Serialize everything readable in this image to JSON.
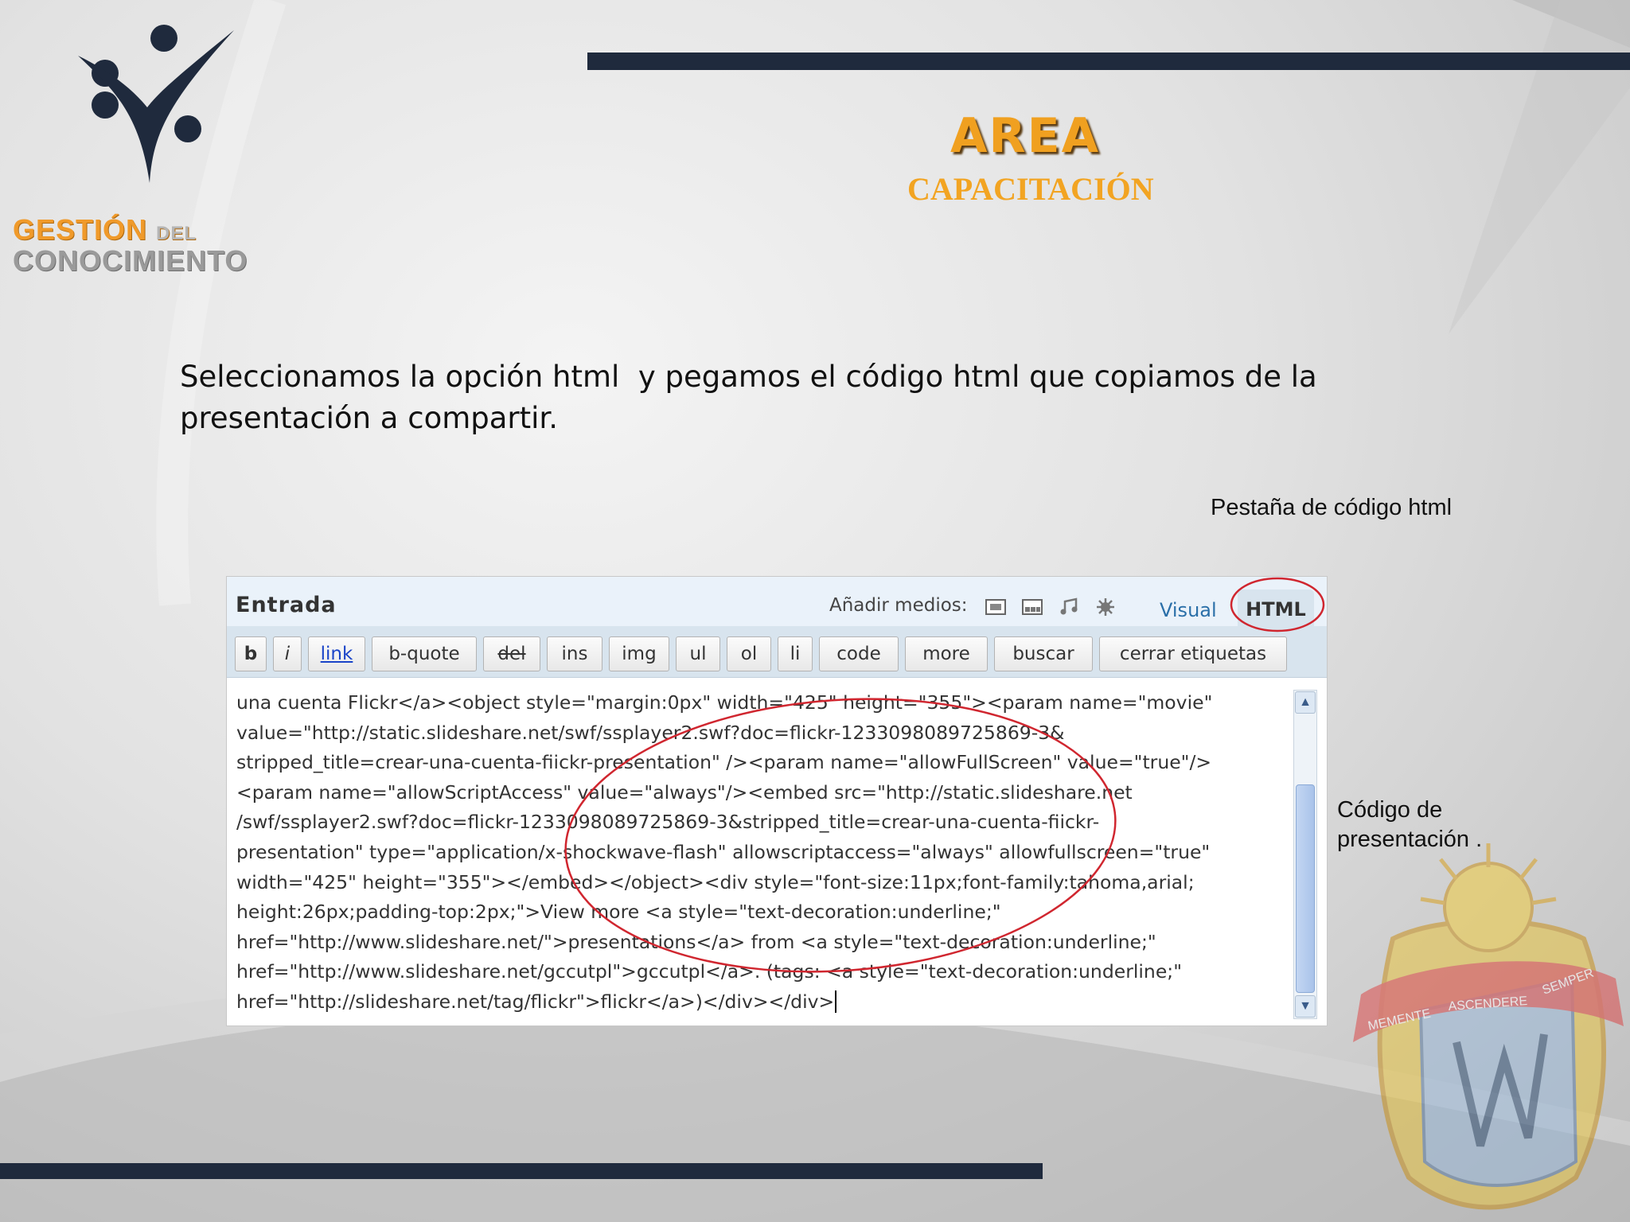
{
  "logo": {
    "line1": "GESTIÓN",
    "line1_small": "DEL",
    "line2": "CONOCIMIENTO"
  },
  "header": {
    "title": "AREA",
    "subtitle": "CAPACITACIÓN"
  },
  "instruction": {
    "line1": "Seleccionamos la opción html  y pegamos el código html que copiamos de la",
    "line2": "presentación a compartir."
  },
  "callouts": {
    "tab_label": "Pestaña de código html",
    "code_label_line1": "Código de",
    "code_label_line2": "presentación ."
  },
  "editor": {
    "title": "Entrada",
    "media_label": "Añadir medios:",
    "media_icons": [
      "image-icon",
      "video-icon",
      "audio-icon",
      "media-icon"
    ],
    "tab_visual": "Visual",
    "tab_html": "HTML",
    "buttons": [
      "b",
      "i",
      "link",
      "b-quote",
      "del",
      "ins",
      "img",
      "ul",
      "ol",
      "li",
      "code",
      "more",
      "buscar",
      "cerrar etiquetas"
    ],
    "content_lines": [
      "una cuenta Flickr</a><object style=\"margin:0px\" width=\"425\" height=\"355\"><param name=\"movie\"",
      "value=\"http://static.slideshare.net/swf/ssplayer2.swf?doc=flickr-1233098089725869-3&",
      "stripped_title=crear-una-cuenta-fiickr-presentation\" /><param name=\"allowFullScreen\" value=\"true\"/>",
      "<param name=\"allowScriptAccess\" value=\"always\"/><embed src=\"http://static.slideshare.net",
      "/swf/ssplayer2.swf?doc=flickr-1233098089725869-3&stripped_title=crear-una-cuenta-fiickr-",
      "presentation\" type=\"application/x-shockwave-flash\" allowscriptaccess=\"always\" allowfullscreen=\"true\"",
      "width=\"425\" height=\"355\"></embed></object><div style=\"font-size:11px;font-family:tahoma,arial;",
      "height:26px;padding-top:2px;\">View more <a style=\"text-decoration:underline;\"",
      "href=\"http://www.slideshare.net/\">presentations</a> from <a style=\"text-decoration:underline;\"",
      "href=\"http://www.slideshare.net/gccutpl\">gccutpl</a>. (tags: <a style=\"text-decoration:underline;\"",
      "href=\"http://slideshare.net/tag/flickr\">flickr</a>)</div></div>"
    ]
  },
  "emblem": {
    "motto_left": "MEMENTE",
    "motto_mid": "ASCENDERE",
    "motto_right": "SEMPER"
  },
  "colors": {
    "navy_bar": "#1f2a3d",
    "orange": "#f0a020",
    "annotation_red": "#d0262f",
    "link_blue": "#2a6fa8"
  }
}
